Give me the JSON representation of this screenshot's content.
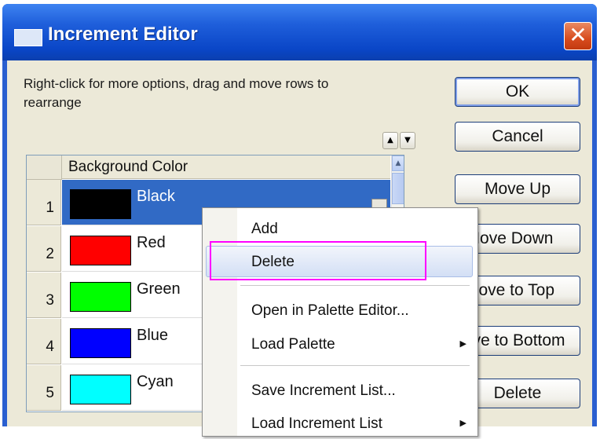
{
  "window": {
    "title": "Increment Editor",
    "close_glyph": "✕"
  },
  "instructions": "Right-click for more options, drag and move rows to  rearrange",
  "buttons": {
    "ok": "OK",
    "cancel": "Cancel",
    "move_up": "Move Up",
    "move_down": "Move Down",
    "move_top": "Move to Top",
    "move_bottom": "Move to Bottom",
    "delete": "Delete"
  },
  "reorder_arrows": {
    "up": "▲",
    "down": "▼"
  },
  "grid": {
    "column_header": "Background Color",
    "rows": [
      {
        "num": "1",
        "label": "Black",
        "color": "#000000",
        "selected": true
      },
      {
        "num": "2",
        "label": "Red",
        "color": "#ff0000"
      },
      {
        "num": "3",
        "label": "Green",
        "color": "#00ff00"
      },
      {
        "num": "4",
        "label": "Blue",
        "color": "#0000ff"
      },
      {
        "num": "5",
        "label": "Cyan",
        "color": "#00ffff"
      }
    ]
  },
  "context_menu": {
    "items": [
      {
        "label": "Add"
      },
      {
        "label": "Delete",
        "highlighted": true
      },
      {
        "label": "Open in Palette Editor..."
      },
      {
        "label": "Load Palette",
        "submenu": true
      },
      {
        "label": "Save Increment List..."
      },
      {
        "label": "Load Increment List",
        "submenu": true
      }
    ],
    "submenu_glyph": "▶"
  },
  "colors": {
    "titlebar": "#0a46c7",
    "selection": "#316ac5",
    "annotation": "#ff00ff"
  }
}
